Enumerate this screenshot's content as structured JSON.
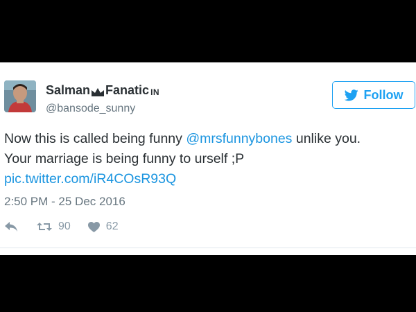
{
  "user": {
    "display_name_first": "Salman",
    "display_name_second": "Fanatic",
    "display_name_suffix": "IN",
    "handle": "@bansode_sunny"
  },
  "follow_button": {
    "label": "Follow",
    "icon": "twitter-bird-icon"
  },
  "tweet": {
    "line1_prefix": "Now this is called being funny ",
    "mention": "@mrsfunnybones",
    "line1_suffix": " unlike you.",
    "line2": "Your marriage is being funny to urself ;P",
    "pic_link": "pic.twitter.com/iR4COsR93Q"
  },
  "timestamp": "2:50 PM - 25 Dec 2016",
  "actions": {
    "reply_icon": "reply-icon",
    "retweet_icon": "retweet-icon",
    "retweet_count": "90",
    "like_icon": "heart-icon",
    "like_count": "62"
  },
  "colors": {
    "accent": "#1da1f2",
    "link": "#1b95e0",
    "text": "#292f33",
    "muted": "#66757f",
    "icon": "#8899a6",
    "background": "#000000"
  }
}
